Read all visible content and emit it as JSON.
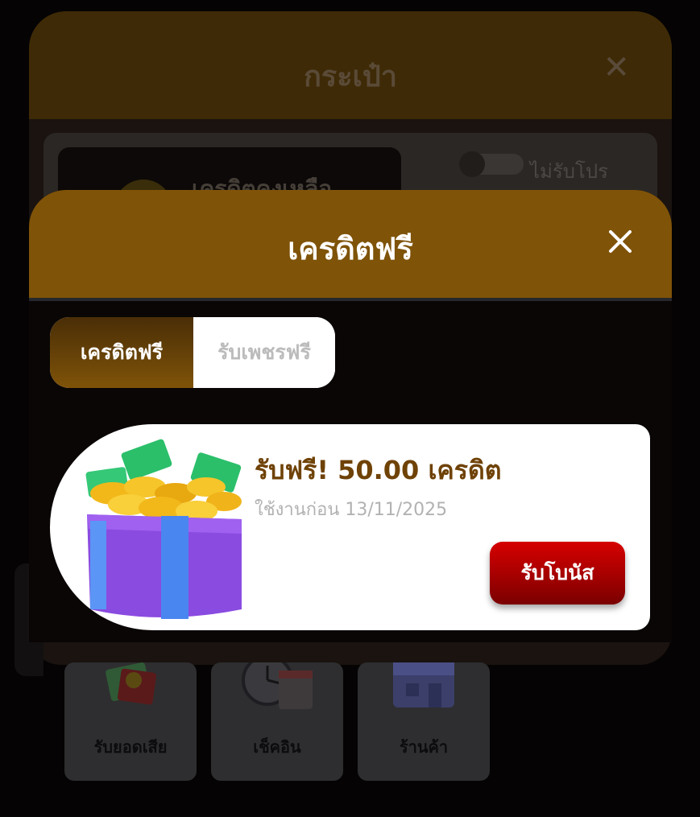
{
  "wallet": {
    "title": "กระเป๋า",
    "credit_label": "เครดิตคงเหลือ",
    "toggle_label": "ไม่รับโปร",
    "tiles": [
      {
        "label": "รับยอดเสีย",
        "icon": "money-refund-icon"
      },
      {
        "label": "เช็คอิน",
        "icon": "clock-calendar-icon"
      },
      {
        "label": "ร้านค้า",
        "icon": "store-icon"
      }
    ]
  },
  "modal": {
    "title": "เครดิตฟรี",
    "tabs": [
      {
        "label": "เครดิตฟรี",
        "active": true
      },
      {
        "label": "รับเพชรฟรี",
        "active": false
      }
    ],
    "offer": {
      "title": "รับฟรี! 50.00 เครดิต",
      "expiry": "ใช้งานก่อน 13/11/2025",
      "button_label": "รับโบนัส",
      "icon": "gift-box-icon"
    }
  },
  "colors": {
    "header_gold": "#7f5308",
    "offer_title": "#6f4206",
    "button_red": "#c00000",
    "background": "#050303"
  }
}
